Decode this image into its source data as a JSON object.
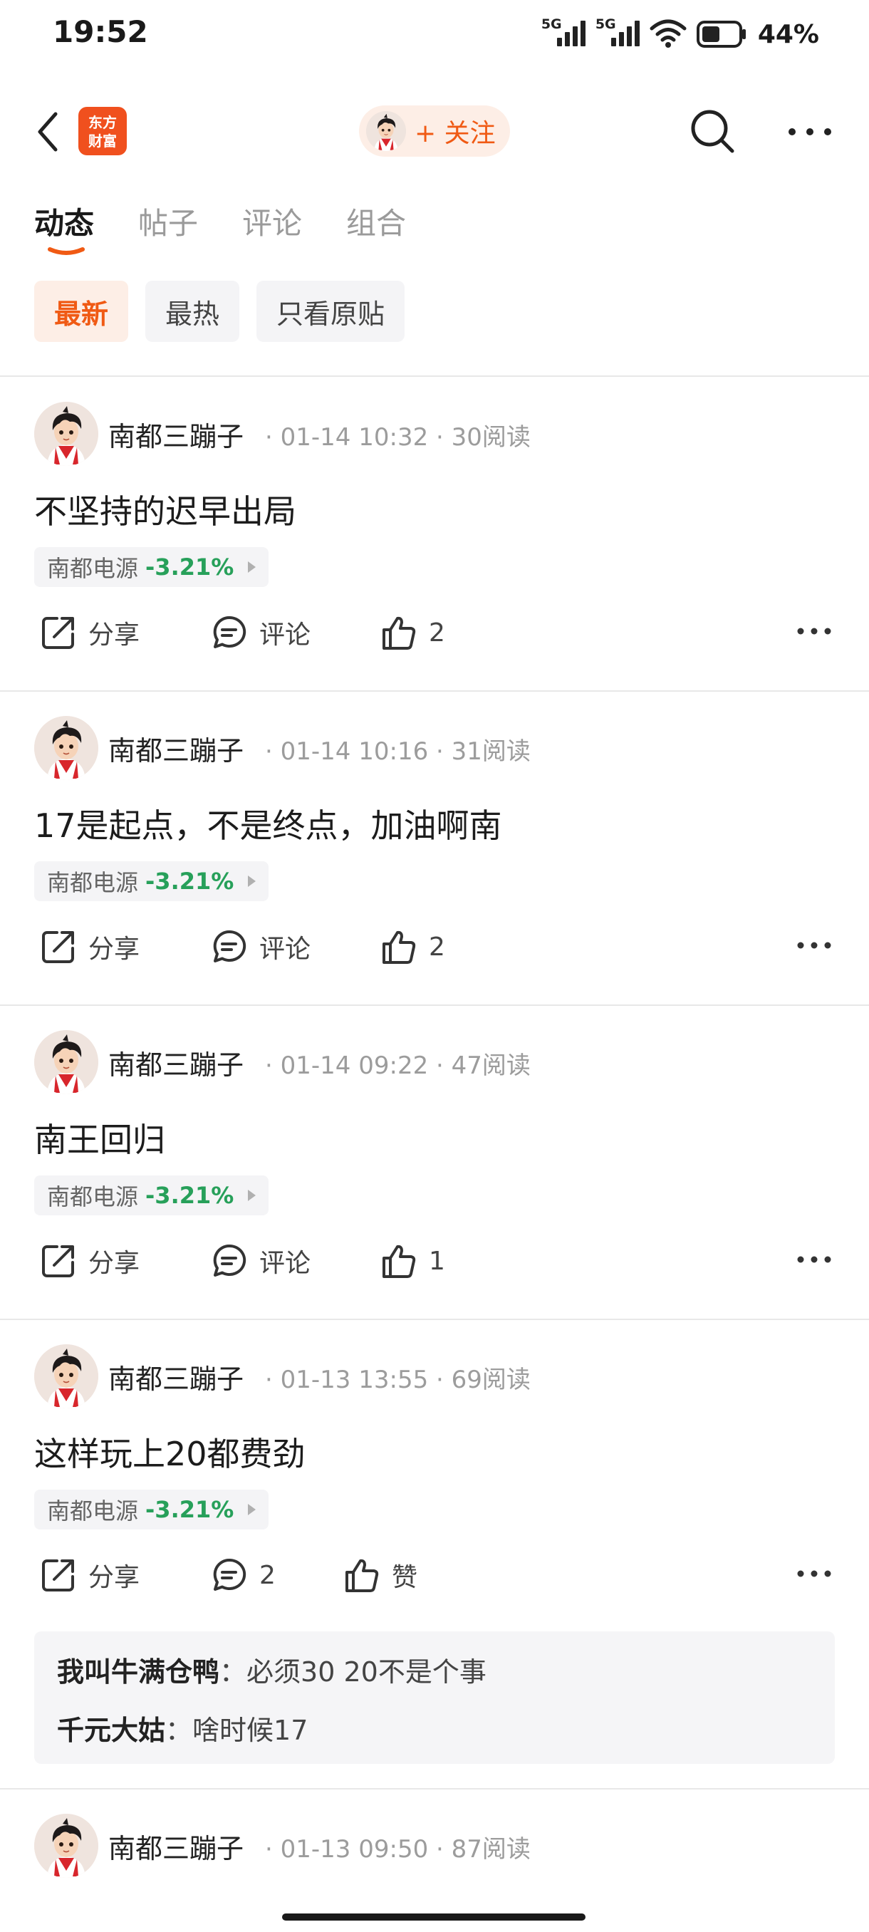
{
  "status": {
    "time": "19:52",
    "sim1": "5G",
    "sim2": "5G",
    "battery": "44%"
  },
  "header": {
    "logo_text": "东方财富",
    "follow_label": "+ 关注"
  },
  "tabs": [
    "动态",
    "帖子",
    "评论",
    "组合"
  ],
  "filters": [
    "最新",
    "最热",
    "只看原贴"
  ],
  "posts": [
    {
      "author": "南都三蹦子",
      "time": "01-14 10:32",
      "reads": "30阅读",
      "text": "不坚持的迟早出局",
      "stock": "南都电源",
      "change": "-3.21%",
      "share": "分享",
      "comment": "评论",
      "likes": "2"
    },
    {
      "author": "南都三蹦子",
      "time": "01-14 10:16",
      "reads": "31阅读",
      "text": "17是起点，不是终点，加油啊南",
      "stock": "南都电源",
      "change": "-3.21%",
      "share": "分享",
      "comment": "评论",
      "likes": "2"
    },
    {
      "author": "南都三蹦子",
      "time": "01-14 09:22",
      "reads": "47阅读",
      "text": "南王回归",
      "stock": "南都电源",
      "change": "-3.21%",
      "share": "分享",
      "comment": "评论",
      "likes": "1"
    },
    {
      "author": "南都三蹦子",
      "time": "01-13 13:55",
      "reads": "69阅读",
      "text": "这样玩上20都费劲",
      "stock": "南都电源",
      "change": "-3.21%",
      "share": "分享",
      "comment": "2",
      "likes": "赞",
      "replies": [
        {
          "user": "我叫牛满仓鸭",
          "sep": "：",
          "text": "必须30 20不是个事"
        },
        {
          "user": "千元大姑",
          "sep": "：",
          "text": "啥时候17"
        }
      ]
    },
    {
      "author": "南都三蹦子",
      "time": "01-13 09:50",
      "reads": "87阅读"
    }
  ],
  "colors": {
    "accent": "#f05a14",
    "down": "#27a05a"
  }
}
